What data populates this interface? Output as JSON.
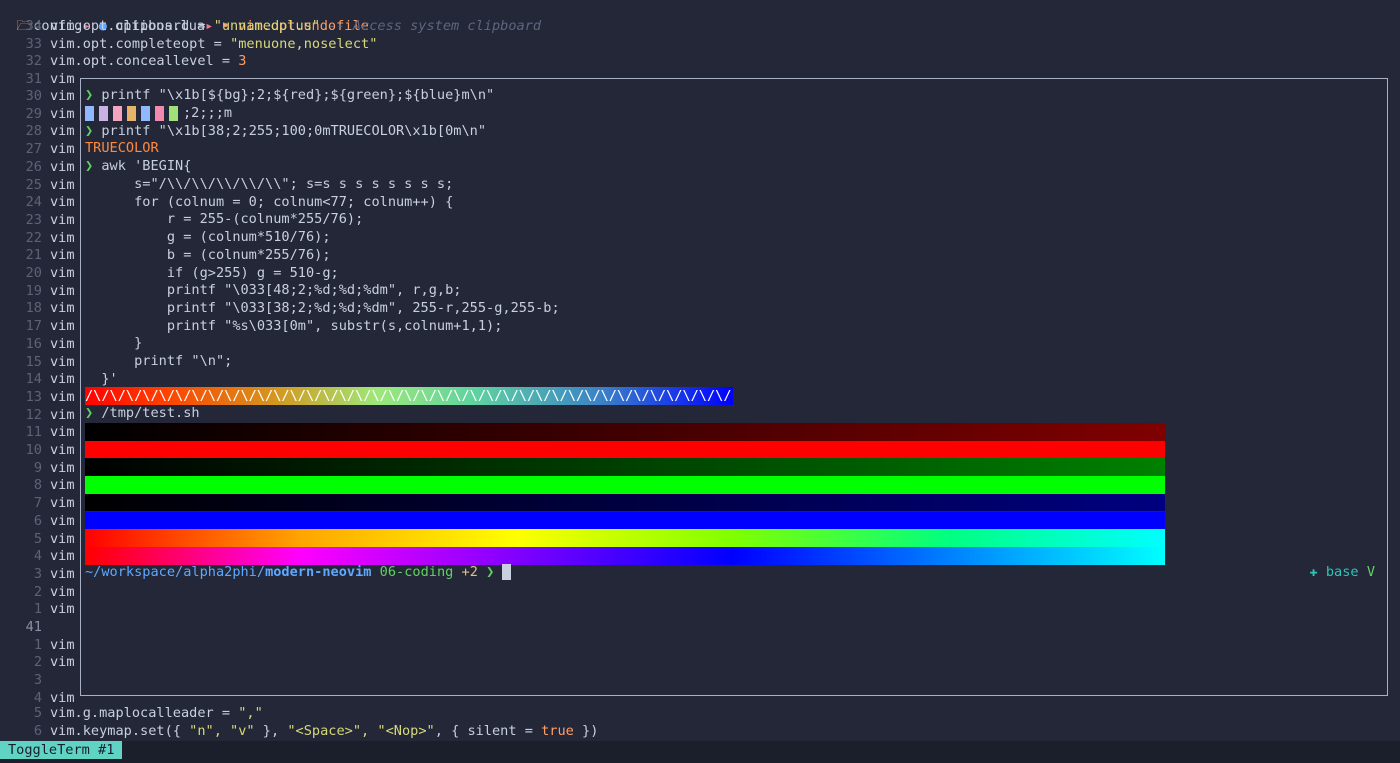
{
  "winbar": {
    "folder_icon": "folder-open-icon",
    "folder": "config",
    "file_icon": "lua-icon",
    "file": "options.lua",
    "symbol": "vim.opt.undofile"
  },
  "editor_top": [
    {
      "ln": "34",
      "code": "vim.opt.clipboard = ",
      "str": "\"unnamedplus\"",
      "cmt": " -- Access system clipboard"
    },
    {
      "ln": "33",
      "code": "vim.opt.completeopt = ",
      "str": "\"menuone,noselect\""
    },
    {
      "ln": "32",
      "code": "vim.opt.conceallevel = ",
      "num": "3"
    },
    {
      "ln": "31",
      "code": "vim"
    }
  ],
  "gutter": [
    {
      "ln": "30",
      "t": "vim"
    },
    {
      "ln": "29",
      "t": "vim"
    },
    {
      "ln": "28",
      "t": "vim"
    },
    {
      "ln": "27",
      "t": "vim"
    },
    {
      "ln": "26",
      "t": "vim"
    },
    {
      "ln": "25",
      "t": "vim"
    },
    {
      "ln": "24",
      "t": "vim"
    },
    {
      "ln": "23",
      "t": "vim"
    },
    {
      "ln": "22",
      "t": "vim"
    },
    {
      "ln": "21",
      "t": "vim"
    },
    {
      "ln": "20",
      "t": "vim"
    },
    {
      "ln": "19",
      "t": "vim"
    },
    {
      "ln": "18",
      "t": "vim"
    },
    {
      "ln": "17",
      "t": "vim"
    },
    {
      "ln": "16",
      "t": "vim"
    },
    {
      "ln": "15",
      "t": "vim"
    },
    {
      "ln": "14",
      "t": "vim"
    },
    {
      "ln": "13",
      "t": "vim"
    },
    {
      "ln": "12",
      "t": "vim"
    },
    {
      "ln": "11",
      "t": "vim"
    },
    {
      "ln": "10",
      "t": "vim"
    },
    {
      "ln": "9",
      "t": "vim"
    },
    {
      "ln": "8",
      "t": "vim"
    },
    {
      "ln": "7",
      "t": "vim"
    },
    {
      "ln": "6",
      "t": "vim"
    },
    {
      "ln": "5",
      "t": "vim"
    },
    {
      "ln": "4",
      "t": "vim"
    },
    {
      "ln": "3",
      "t": "vim"
    },
    {
      "ln": "2",
      "t": "vim"
    },
    {
      "ln": "1",
      "t": "vim"
    },
    {
      "ln": "41",
      "t": "",
      "current": true
    },
    {
      "ln": "1",
      "t": "vim"
    },
    {
      "ln": "2",
      "t": "vim"
    },
    {
      "ln": "3",
      "t": ""
    },
    {
      "ln": "4",
      "t": "vim"
    }
  ],
  "editor_bottom": [
    {
      "ln": "5",
      "code": "vim.g.maplocalleader = ",
      "str": "\",\""
    },
    {
      "ln": "6",
      "code": "vim.keymap.set({ ",
      "str": "\"n\", \"v\"",
      "rest": " }, ",
      "str2": "\"<Space>\", \"<Nop>\"",
      "rest2": ", { silent = ",
      "kw": "true",
      "rest3": " })"
    }
  ],
  "terminal": {
    "prompt_symbol": "❯",
    "cmd1": "printf \"\\x1b[${bg};2;${red};${green};${blue}m\\n\"",
    "out1_text": ";2;;;m",
    "swatches": [
      "#8fb8ff",
      "#c9b3e6",
      "#f5a4c0",
      "#e6b36b",
      "#8fb8ff",
      "#f08ab0",
      "#9fe07a"
    ],
    "cmd2": "printf \"\\x1b[38;2;255;100;0mTRUECOLOR\\x1b[0m\\n\"",
    "out2": "TRUECOLOR",
    "awk_lines": [
      "awk 'BEGIN{",
      "    s=\"/\\\\/\\\\/\\\\/\\\\/\\\\\"; s=s s s s s s s s;",
      "    for (colnum = 0; colnum<77; colnum++) {",
      "        r = 255-(colnum*255/76);",
      "        g = (colnum*510/76);",
      "        b = (colnum*255/76);",
      "        if (g>255) g = 510-g;",
      "        printf \"\\033[48;2;%d;%d;%dm\", r,g,b;",
      "        printf \"\\033[38;2;%d;%d;%dm\", 255-r,255-g,255-b;",
      "        printf \"%s\\033[0m\", substr(s,colnum+1,1);",
      "    }",
      "    printf \"\\n\";",
      "}'"
    ],
    "zigzag": "/\\/\\/\\/\\/\\/\\/\\/\\/\\/\\/\\/\\/\\/\\/\\/\\/\\/\\/\\/\\/\\/\\/\\/\\/\\/\\/\\/\\/\\/\\/\\/\\/\\/\\/\\/\\/\\/\\/\\/",
    "cmd3": "/tmp/test.sh",
    "bars": [
      "linear-gradient(to right,#000000,#800000)",
      "linear-gradient(to right,#ff0000,#ff0000)",
      "linear-gradient(to right,#000000,#008000)",
      "linear-gradient(to right,#00ff00,#00ff00)",
      "linear-gradient(to right,#000000,#000080)",
      "linear-gradient(to right,#0000ff,#0000ff)",
      "linear-gradient(to right,#ff0000,#ffa500,#ffff00,#80ff00,#00ff80,#00ffff)",
      "linear-gradient(to right,#ff0000,#ff00ff,#8000ff,#0000ff,#0080ff,#00ffff)"
    ],
    "cwd_home": "~/workspace/alpha2phi/",
    "cwd_repo": "modern-neovim",
    "branch": "06-coding",
    "changes": "+2",
    "env_icon": "conda-icon",
    "env": "base",
    "check": "V"
  },
  "toggleterm": {
    "label": "ToggleTerm #1"
  }
}
